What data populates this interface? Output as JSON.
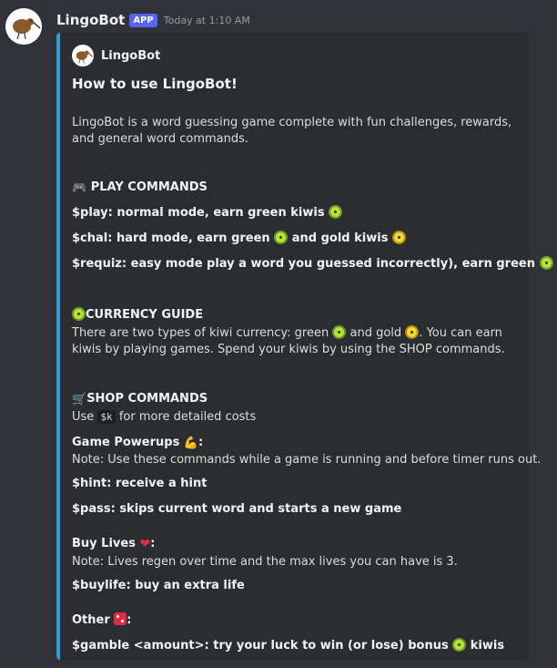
{
  "message": {
    "username": "LingoBot",
    "badge": "APP",
    "timestamp": "Today at 1:10 AM",
    "avatar_icon": "kiwi-bird-avatar"
  },
  "embed": {
    "author": "LingoBot",
    "title": "How to use LingoBot!",
    "intro": "LingoBot is a word guessing game complete with fun challenges, rewards, and general word commands.",
    "accent_color": "#3498db",
    "play": {
      "heading": "PLAY COMMANDS",
      "cmd1": "$play: normal mode, earn green kiwis",
      "cmd2a": "$chal: hard mode, earn green",
      "cmd2b": "and gold kiwis",
      "cmd3": "$requiz: easy mode play a word you guessed incorrectly), earn green"
    },
    "currency": {
      "heading": "CURRENCY GUIDE",
      "text_a": "There are two types of kiwi currency: green",
      "text_b": "and gold",
      "text_c": ". You can earn kiwis by playing games. Spend your kiwis by using the SHOP commands."
    },
    "shop": {
      "heading": "SHOP COMMANDS",
      "use_a": "Use",
      "use_code": "$k",
      "use_b": "for more detailed costs",
      "powerups_label": "Game Powerups",
      "powerups_note": "Note: Use these commands while a game is running and before timer runs out.",
      "hint": "$hint: receive a hint",
      "pass": "$pass: skips current word and starts a new game",
      "lives_label": "Buy Lives",
      "lives_note": "Note: Lives regen over time and the max lives you can have is 3.",
      "buylife": "$buylife: buy an extra life",
      "other_label": "Other",
      "gamble_a": "$gamble <amount>: try your luck to win (or lose) bonus",
      "gamble_b": "kiwis"
    },
    "colon": ":"
  }
}
